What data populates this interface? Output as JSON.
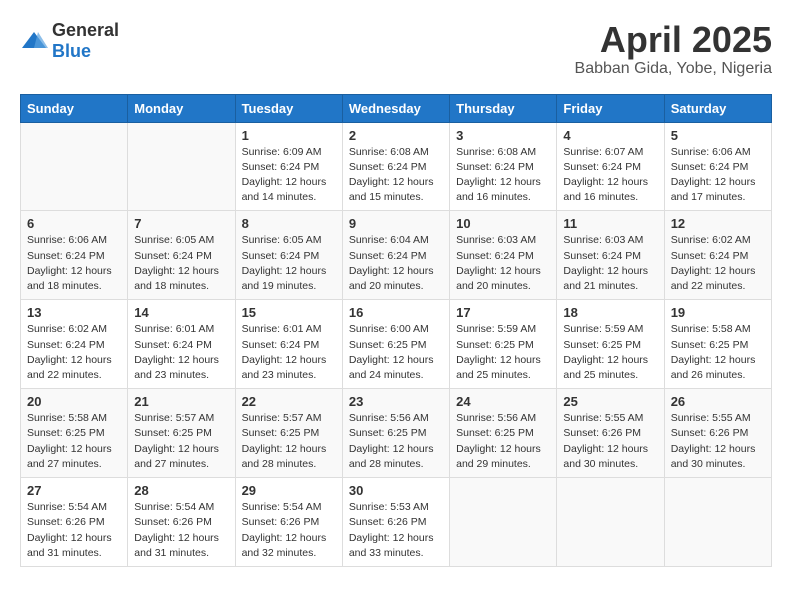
{
  "header": {
    "logo_general": "General",
    "logo_blue": "Blue",
    "month": "April 2025",
    "location": "Babban Gida, Yobe, Nigeria"
  },
  "days_of_week": [
    "Sunday",
    "Monday",
    "Tuesday",
    "Wednesday",
    "Thursday",
    "Friday",
    "Saturday"
  ],
  "weeks": [
    [
      {
        "day": "",
        "info": ""
      },
      {
        "day": "",
        "info": ""
      },
      {
        "day": "1",
        "info": "Sunrise: 6:09 AM\nSunset: 6:24 PM\nDaylight: 12 hours and 14 minutes."
      },
      {
        "day": "2",
        "info": "Sunrise: 6:08 AM\nSunset: 6:24 PM\nDaylight: 12 hours and 15 minutes."
      },
      {
        "day": "3",
        "info": "Sunrise: 6:08 AM\nSunset: 6:24 PM\nDaylight: 12 hours and 16 minutes."
      },
      {
        "day": "4",
        "info": "Sunrise: 6:07 AM\nSunset: 6:24 PM\nDaylight: 12 hours and 16 minutes."
      },
      {
        "day": "5",
        "info": "Sunrise: 6:06 AM\nSunset: 6:24 PM\nDaylight: 12 hours and 17 minutes."
      }
    ],
    [
      {
        "day": "6",
        "info": "Sunrise: 6:06 AM\nSunset: 6:24 PM\nDaylight: 12 hours and 18 minutes."
      },
      {
        "day": "7",
        "info": "Sunrise: 6:05 AM\nSunset: 6:24 PM\nDaylight: 12 hours and 18 minutes."
      },
      {
        "day": "8",
        "info": "Sunrise: 6:05 AM\nSunset: 6:24 PM\nDaylight: 12 hours and 19 minutes."
      },
      {
        "day": "9",
        "info": "Sunrise: 6:04 AM\nSunset: 6:24 PM\nDaylight: 12 hours and 20 minutes."
      },
      {
        "day": "10",
        "info": "Sunrise: 6:03 AM\nSunset: 6:24 PM\nDaylight: 12 hours and 20 minutes."
      },
      {
        "day": "11",
        "info": "Sunrise: 6:03 AM\nSunset: 6:24 PM\nDaylight: 12 hours and 21 minutes."
      },
      {
        "day": "12",
        "info": "Sunrise: 6:02 AM\nSunset: 6:24 PM\nDaylight: 12 hours and 22 minutes."
      }
    ],
    [
      {
        "day": "13",
        "info": "Sunrise: 6:02 AM\nSunset: 6:24 PM\nDaylight: 12 hours and 22 minutes."
      },
      {
        "day": "14",
        "info": "Sunrise: 6:01 AM\nSunset: 6:24 PM\nDaylight: 12 hours and 23 minutes."
      },
      {
        "day": "15",
        "info": "Sunrise: 6:01 AM\nSunset: 6:24 PM\nDaylight: 12 hours and 23 minutes."
      },
      {
        "day": "16",
        "info": "Sunrise: 6:00 AM\nSunset: 6:25 PM\nDaylight: 12 hours and 24 minutes."
      },
      {
        "day": "17",
        "info": "Sunrise: 5:59 AM\nSunset: 6:25 PM\nDaylight: 12 hours and 25 minutes."
      },
      {
        "day": "18",
        "info": "Sunrise: 5:59 AM\nSunset: 6:25 PM\nDaylight: 12 hours and 25 minutes."
      },
      {
        "day": "19",
        "info": "Sunrise: 5:58 AM\nSunset: 6:25 PM\nDaylight: 12 hours and 26 minutes."
      }
    ],
    [
      {
        "day": "20",
        "info": "Sunrise: 5:58 AM\nSunset: 6:25 PM\nDaylight: 12 hours and 27 minutes."
      },
      {
        "day": "21",
        "info": "Sunrise: 5:57 AM\nSunset: 6:25 PM\nDaylight: 12 hours and 27 minutes."
      },
      {
        "day": "22",
        "info": "Sunrise: 5:57 AM\nSunset: 6:25 PM\nDaylight: 12 hours and 28 minutes."
      },
      {
        "day": "23",
        "info": "Sunrise: 5:56 AM\nSunset: 6:25 PM\nDaylight: 12 hours and 28 minutes."
      },
      {
        "day": "24",
        "info": "Sunrise: 5:56 AM\nSunset: 6:25 PM\nDaylight: 12 hours and 29 minutes."
      },
      {
        "day": "25",
        "info": "Sunrise: 5:55 AM\nSunset: 6:26 PM\nDaylight: 12 hours and 30 minutes."
      },
      {
        "day": "26",
        "info": "Sunrise: 5:55 AM\nSunset: 6:26 PM\nDaylight: 12 hours and 30 minutes."
      }
    ],
    [
      {
        "day": "27",
        "info": "Sunrise: 5:54 AM\nSunset: 6:26 PM\nDaylight: 12 hours and 31 minutes."
      },
      {
        "day": "28",
        "info": "Sunrise: 5:54 AM\nSunset: 6:26 PM\nDaylight: 12 hours and 31 minutes."
      },
      {
        "day": "29",
        "info": "Sunrise: 5:54 AM\nSunset: 6:26 PM\nDaylight: 12 hours and 32 minutes."
      },
      {
        "day": "30",
        "info": "Sunrise: 5:53 AM\nSunset: 6:26 PM\nDaylight: 12 hours and 33 minutes."
      },
      {
        "day": "",
        "info": ""
      },
      {
        "day": "",
        "info": ""
      },
      {
        "day": "",
        "info": ""
      }
    ]
  ]
}
